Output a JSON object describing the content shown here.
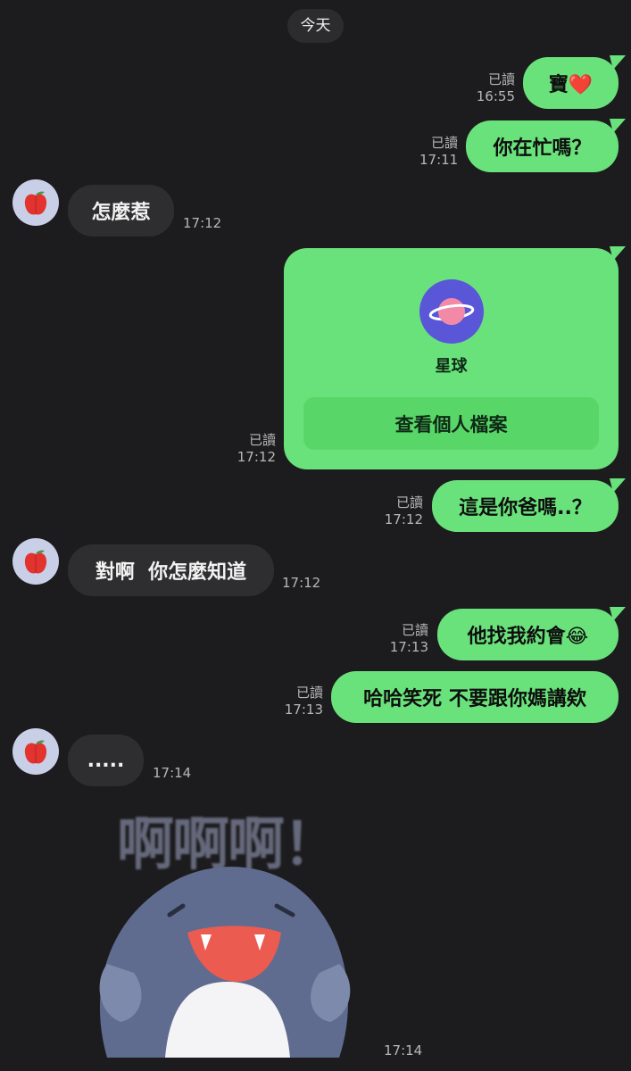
{
  "date_divider": "今天",
  "messages": [
    {
      "side": "me",
      "text": "寶❤️",
      "read": "已讀",
      "time": "16:55"
    },
    {
      "side": "me",
      "text": "你在忙嗎？",
      "read": "已讀",
      "time": "17:11"
    },
    {
      "side": "them",
      "text": "怎麼惹",
      "time": "17:12"
    },
    {
      "side": "me",
      "type": "profile_card",
      "read": "已讀",
      "time": "17:12",
      "card_name": "星球",
      "card_button": "查看個人檔案"
    },
    {
      "side": "me",
      "text": "這是你爸嗎..？",
      "read": "已讀",
      "time": "17:12"
    },
    {
      "side": "them",
      "text": "對啊  你怎麼知道",
      "time": "17:12"
    },
    {
      "side": "me",
      "text": "他找我約會😂",
      "read": "已讀",
      "time": "17:13"
    },
    {
      "side": "me",
      "text": "哈哈笑死 不要跟你媽講欸",
      "read": "已讀",
      "time": "17:13"
    },
    {
      "side": "them",
      "text": ".....",
      "time": "17:14"
    },
    {
      "side": "them",
      "type": "sticker",
      "sticker_text": "啊啊啊！",
      "time": "17:14"
    }
  ],
  "colors": {
    "background": "#1c1c1e",
    "sent_bubble": "#6ae27b",
    "received_bubble": "#2e2e30",
    "avatar_bg": "#c9cfe7"
  },
  "icons": {
    "avatar": "apple-icon",
    "card_avatar": "planet-icon",
    "sticker": "shark-sticker"
  }
}
